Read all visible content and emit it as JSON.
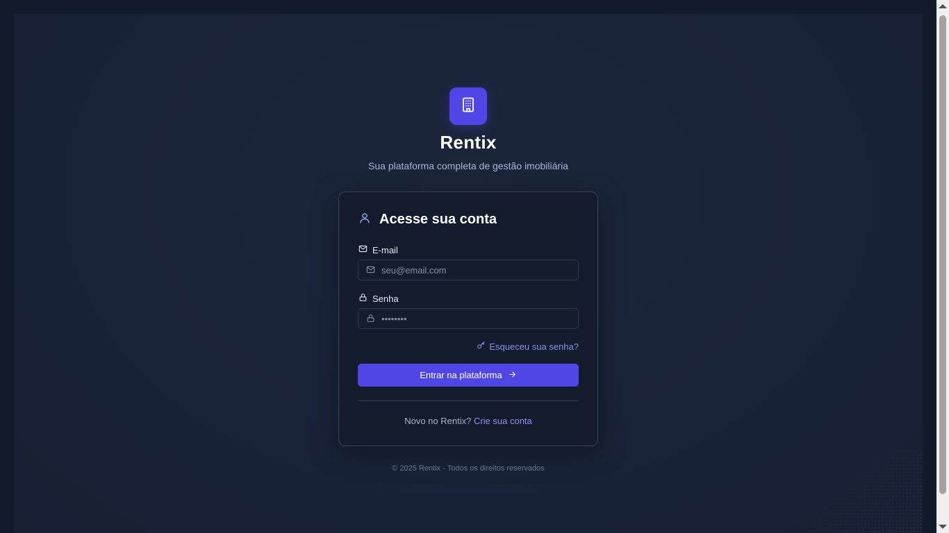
{
  "brand": {
    "name": "Rentix",
    "tagline": "Sua plataforma completa de gestão imobiliária",
    "logo_icon": "building-icon",
    "accent_color": "#4f46e5"
  },
  "login": {
    "title": "Acesse sua conta",
    "title_icon": "user-icon",
    "email": {
      "label": "E-mail",
      "icon": "mail-icon",
      "placeholder": "seu@email.com",
      "value": ""
    },
    "password": {
      "label": "Senha",
      "icon": "lock-icon",
      "placeholder": "••••••••",
      "value": ""
    },
    "forgot_password": {
      "label": "Esqueceu sua senha?",
      "icon": "key-icon"
    },
    "submit": {
      "label": "Entrar na plataforma",
      "icon": "arrow-right-icon"
    },
    "signup": {
      "prompt": "Novo no Rentix?",
      "link": "Crie sua conta"
    }
  },
  "footer": {
    "text": "© 2025 Rentix - Todos os direitos reservados"
  }
}
